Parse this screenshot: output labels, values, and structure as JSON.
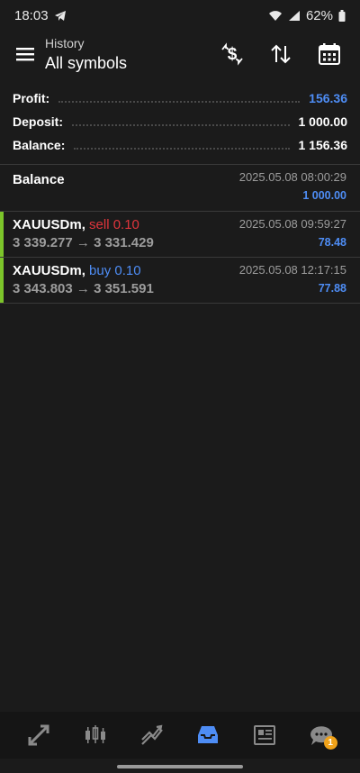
{
  "status_bar": {
    "time": "18:03",
    "battery": "62%",
    "icons": [
      "telegram-icon",
      "wifi-icon",
      "signal-icon",
      "battery-icon"
    ]
  },
  "header": {
    "subtitle": "History",
    "title": "All symbols",
    "icons": [
      "menu-icon",
      "dollar-exchange-icon",
      "sort-icon",
      "calendar-icon"
    ]
  },
  "summary": {
    "profit_label": "Profit:",
    "profit_value": "156.36",
    "deposit_label": "Deposit:",
    "deposit_value": "1 000.00",
    "balance_label": "Balance:",
    "balance_value": "1 156.36"
  },
  "records": [
    {
      "title": "Balance",
      "time": "2025.05.08 08:00:29",
      "amount": "1 000.00"
    },
    {
      "symbol": "XAUUSDm",
      "sep": ",",
      "type": "sell 0.10",
      "prices": "3 339.277 → 3 331.429",
      "time": "2025.05.08 09:59:27",
      "profit": "78.48"
    },
    {
      "symbol": "XAUUSDm",
      "sep": ",",
      "type": "buy 0.10",
      "prices": "3 343.803 → 3 351.591",
      "time": "2025.05.08 12:17:15",
      "profit": "77.88"
    }
  ],
  "bottom_nav": {
    "items": [
      "quotes-icon",
      "chart-icon",
      "trade-icon",
      "history-icon",
      "news-icon",
      "messages-icon"
    ],
    "active": "history-icon",
    "messages_badge": "1"
  },
  "colors": {
    "background": "#1b1b1b",
    "accent_blue": "#4e8df5",
    "sell_red": "#e0353c",
    "row_accent_green": "#7cc52a",
    "badge_orange": "#f0a21a"
  }
}
